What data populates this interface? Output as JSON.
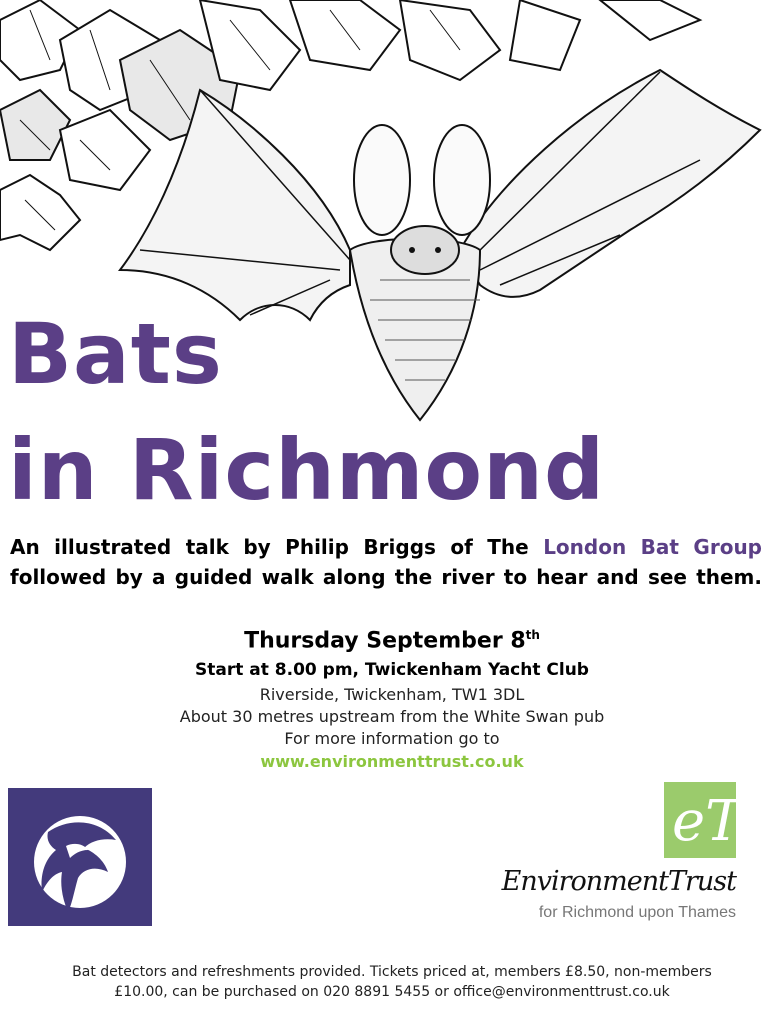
{
  "title": {
    "line1": "Bats",
    "line2": "in Richmond"
  },
  "intro": {
    "before": "An illustrated talk by Philip Briggs of The",
    "org": "London Bat Group",
    "after": "followed by a guided walk along the river to hear and see them."
  },
  "event": {
    "date_main": "Thursday September 8",
    "date_suffix": "th",
    "start": "Start at 8.00 pm, Twickenham Yacht Club",
    "address": "Riverside, Twickenham, TW1 3DL",
    "directions": "About 30 metres upstream from the White Swan pub",
    "more_info": "For more information go to",
    "website": "www.environmenttrust.co.uk"
  },
  "logos": {
    "bat_group": {
      "icon": "bat-moon-logo-icon",
      "color": "#433a7c"
    },
    "environment_trust": {
      "badge_text": "eT",
      "name_part1": "Environment",
      "name_part2": "Trust",
      "subtitle": "for Richmond upon Thames",
      "color": "#9bcb6c"
    }
  },
  "footer": {
    "line1": "Bat detectors and refreshments provided. Tickets priced at, members £8.50, non-members",
    "line2": "£10.00, can be purchased on 020 8891 5455 or office@environmenttrust.co.uk"
  },
  "colors": {
    "title": "#5b3f86",
    "link": "#8cc63f"
  }
}
